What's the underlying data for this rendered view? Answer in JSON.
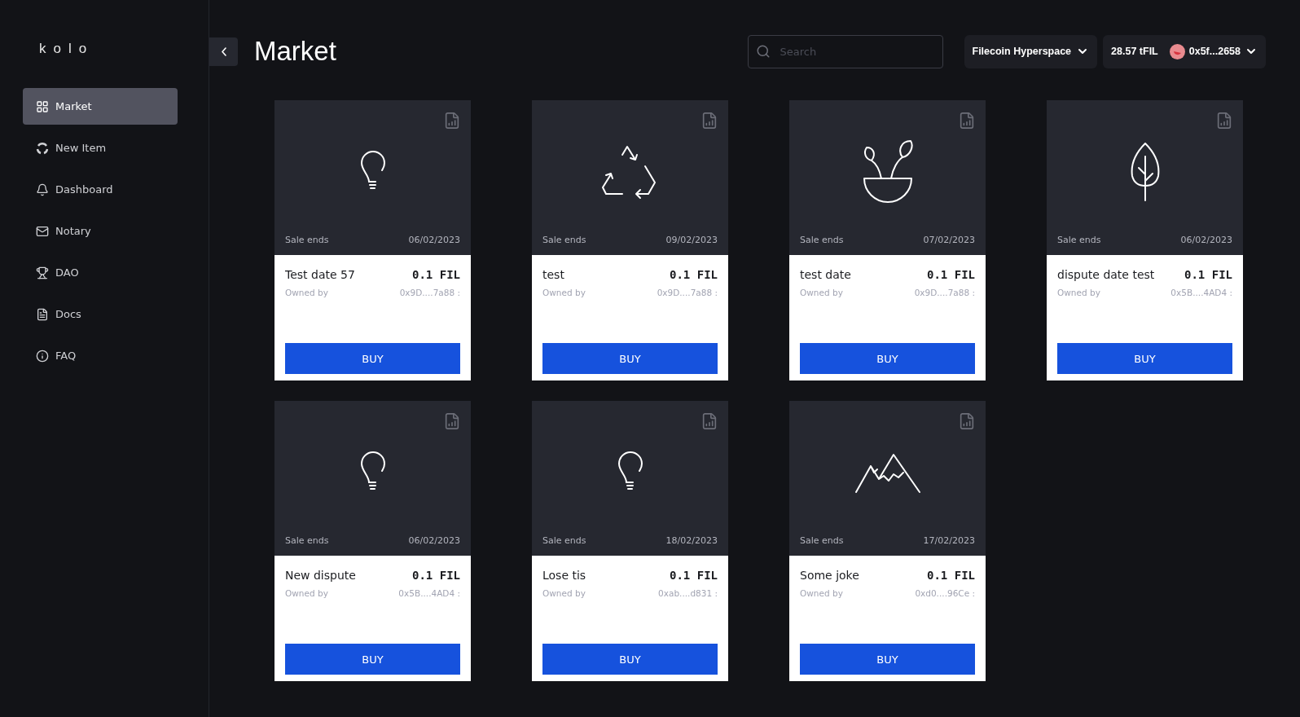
{
  "sidebar": {
    "logo": "kolo",
    "items": [
      {
        "label": "Market",
        "selected": true
      },
      {
        "label": "New Item",
        "selected": false
      },
      {
        "label": "Dashboard",
        "selected": false
      },
      {
        "label": "Notary",
        "selected": false
      },
      {
        "label": "DAO",
        "selected": false
      },
      {
        "label": "Docs",
        "selected": false
      },
      {
        "label": "FAQ",
        "selected": false
      }
    ]
  },
  "header": {
    "title": "Market",
    "search": {
      "placeholder": "Search"
    },
    "network": "Filecoin Hyperspace",
    "balance": "28.57 tFIL",
    "wallet": "0x5f...2658"
  },
  "items": [
    {
      "kind": "bulb",
      "sale_label": "Sale ends",
      "date": "06/02/2023",
      "name": "Test date 57",
      "price": "0.1 FIL",
      "owner_label": "Owned by",
      "owner": "0x9D....7a88 :",
      "button": "BUY"
    },
    {
      "kind": "recycle",
      "sale_label": "Sale ends",
      "date": "09/02/2023",
      "name": "test",
      "price": "0.1 FIL",
      "owner_label": "Owned by",
      "owner": "0x9D....7a88 :",
      "button": "BUY"
    },
    {
      "kind": "plant",
      "sale_label": "Sale ends",
      "date": "07/02/2023",
      "name": "test date",
      "price": "0.1 FIL",
      "owner_label": "Owned by",
      "owner": "0x9D....7a88 :",
      "button": "BUY"
    },
    {
      "kind": "leaf",
      "sale_label": "Sale ends",
      "date": "06/02/2023",
      "name": "dispute date test",
      "price": "0.1 FIL",
      "owner_label": "Owned by",
      "owner": "0x5B....4AD4 :",
      "button": "BUY"
    },
    {
      "kind": "bulb",
      "sale_label": "Sale ends",
      "date": "06/02/2023",
      "name": "New dispute",
      "price": "0.1 FIL",
      "owner_label": "Owned by",
      "owner": "0x5B....4AD4 :",
      "button": "BUY"
    },
    {
      "kind": "bulb",
      "sale_label": "Sale ends",
      "date": "18/02/2023",
      "name": "Lose tis",
      "price": "0.1 FIL",
      "owner_label": "Owned by",
      "owner": "0xab....d831 :",
      "button": "BUY"
    },
    {
      "kind": "mountain",
      "sale_label": "Sale ends",
      "date": "17/02/2023",
      "name": "Some joke",
      "price": "0.1 FIL",
      "owner_label": "Owned by",
      "owner": "0xd0....96Ce :",
      "button": "BUY"
    }
  ]
}
